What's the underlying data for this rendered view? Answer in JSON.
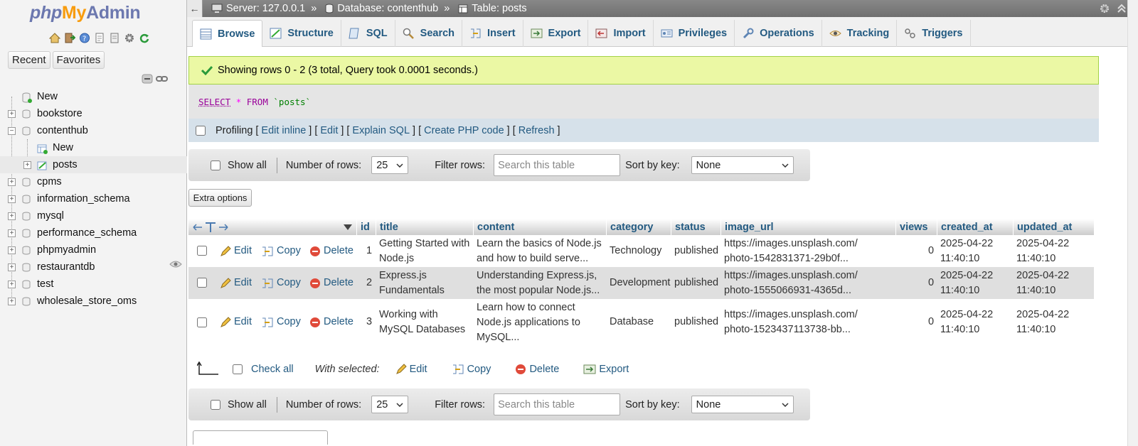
{
  "app": {
    "logo_php": "php",
    "logo_my": "My",
    "logo_admin": "Admin"
  },
  "sidebar": {
    "recent_label": "Recent",
    "favorites_label": "Favorites",
    "tree": [
      {
        "label": "New",
        "type": "new"
      },
      {
        "label": "bookstore",
        "type": "db"
      },
      {
        "label": "contenthub",
        "type": "db",
        "expanded": true
      },
      {
        "label": "New",
        "type": "new-child"
      },
      {
        "label": "posts",
        "type": "table-child",
        "selected": true
      },
      {
        "label": "cpms",
        "type": "db"
      },
      {
        "label": "information_schema",
        "type": "db"
      },
      {
        "label": "mysql",
        "type": "db"
      },
      {
        "label": "performance_schema",
        "type": "db"
      },
      {
        "label": "phpmyadmin",
        "type": "db"
      },
      {
        "label": "restaurantdb",
        "type": "db"
      },
      {
        "label": "test",
        "type": "db"
      },
      {
        "label": "wholesale_store_oms",
        "type": "db"
      }
    ]
  },
  "breadcrumb": {
    "server": "Server: 127.0.0.1",
    "database": "Database: contenthub",
    "table": "Table: posts",
    "sep": "»"
  },
  "tabs": [
    "Browse",
    "Structure",
    "SQL",
    "Search",
    "Insert",
    "Export",
    "Import",
    "Privileges",
    "Operations",
    "Tracking",
    "Triggers"
  ],
  "result": {
    "message": "Showing rows 0 - 2 (3 total, Query took 0.0001 seconds.)",
    "sql_select": "SELECT",
    "sql_star": "*",
    "sql_from": "FROM",
    "sql_table": "`posts`"
  },
  "profiling": {
    "label": "Profiling",
    "links": [
      "Edit inline",
      "Edit",
      "Explain SQL",
      "Create PHP code",
      "Refresh"
    ]
  },
  "navbar": {
    "show_all": "Show all",
    "rows_label": "Number of rows:",
    "rows_value": "25",
    "filter_label": "Filter rows:",
    "filter_placeholder": "Search this table",
    "sort_label": "Sort by key:",
    "sort_value": "None"
  },
  "extra_options": "Extra options",
  "columns": [
    "id",
    "title",
    "content",
    "category",
    "status",
    "image_url",
    "views",
    "created_at",
    "updated_at"
  ],
  "row_actions": {
    "edit": "Edit",
    "copy": "Copy",
    "delete": "Delete"
  },
  "rows": [
    {
      "id": "1",
      "title1": "Getting Started with",
      "title2": "Node.js",
      "content1": "Learn the basics of Node.js",
      "content2": "and how to build serve...",
      "content3": "",
      "category": "Technology",
      "status": "published",
      "url1": "https://images.unsplash.com/",
      "url2": "photo-1542831371-29b0f...",
      "views": "0",
      "created1": "2025-04-22",
      "created2": "11:40:10",
      "updated1": "2025-04-22",
      "updated2": "11:40:10"
    },
    {
      "id": "2",
      "title1": "Express.js",
      "title2": "Fundamentals",
      "content1": "Understanding Express.js,",
      "content2": "the most popular Node.js...",
      "content3": "",
      "category": "Development",
      "status": "published",
      "url1": "https://images.unsplash.com/",
      "url2": "photo-1555066931-4365d...",
      "views": "0",
      "created1": "2025-04-22",
      "created2": "11:40:10",
      "updated1": "2025-04-22",
      "updated2": "11:40:10"
    },
    {
      "id": "3",
      "title1": "Working with",
      "title2": "MySQL Databases",
      "content1": "Learn how to connect",
      "content2": "Node.js applications to",
      "content3": "MySQL...",
      "category": "Database",
      "status": "published",
      "url1": "https://images.unsplash.com/",
      "url2": "photo-1523437113738-bb...",
      "views": "0",
      "created1": "2025-04-22",
      "created2": "11:40:10",
      "updated1": "2025-04-22",
      "updated2": "11:40:10"
    }
  ],
  "with_selected": {
    "check_all": "Check all",
    "label": "With selected:",
    "edit": "Edit",
    "copy": "Copy",
    "delete": "Delete",
    "export": "Export"
  },
  "colors": {
    "link": "#235a81",
    "success_bg": "#ebf8a4",
    "topbar": "#7a7a7a"
  }
}
